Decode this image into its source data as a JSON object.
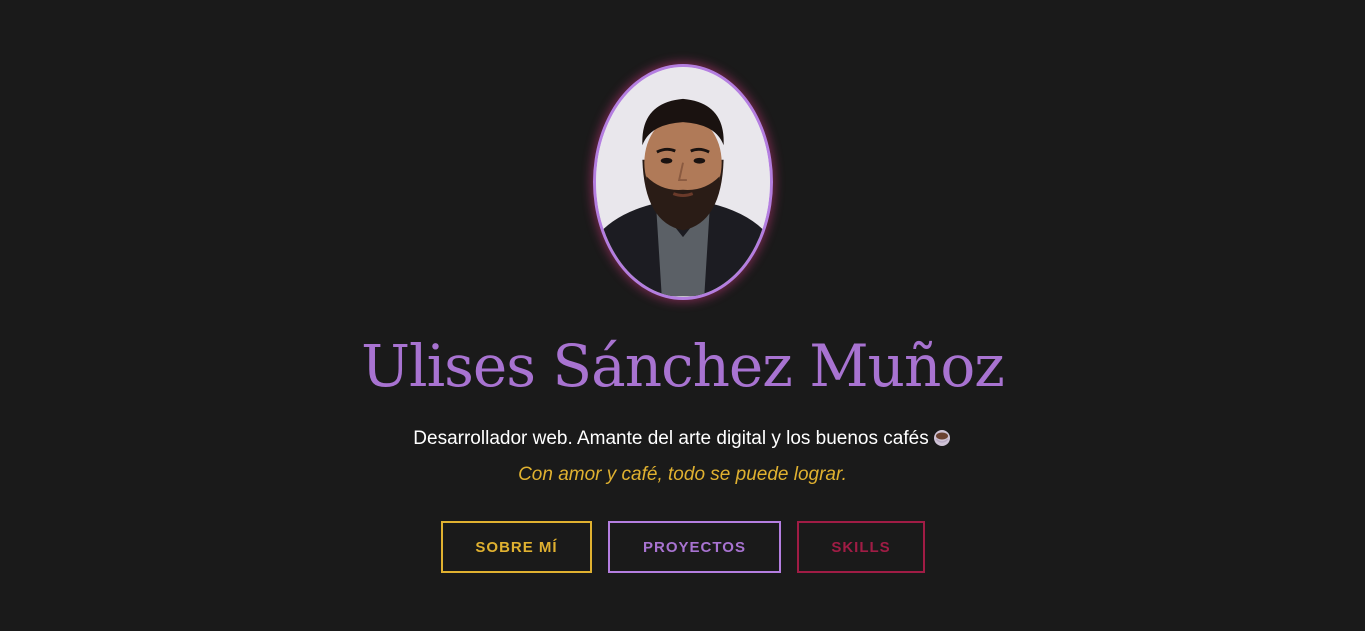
{
  "profile": {
    "name": "Ulises Sánchez Muñoz",
    "bio": "Desarrollador web. Amante del arte digital y los buenos cafés",
    "motto": "Con amor y café, todo se puede lograr."
  },
  "nav": {
    "about_label": "SOBRE MÍ",
    "projects_label": "PROYECTOS",
    "skills_label": "SKILLS"
  },
  "colors": {
    "background": "#1a1a1a",
    "purple": "#a873d1",
    "gold": "#e0b130",
    "crimson": "#a01c45",
    "glow": "#e63c8c"
  },
  "icons": {
    "bio_emoji": "coffee-icon"
  }
}
